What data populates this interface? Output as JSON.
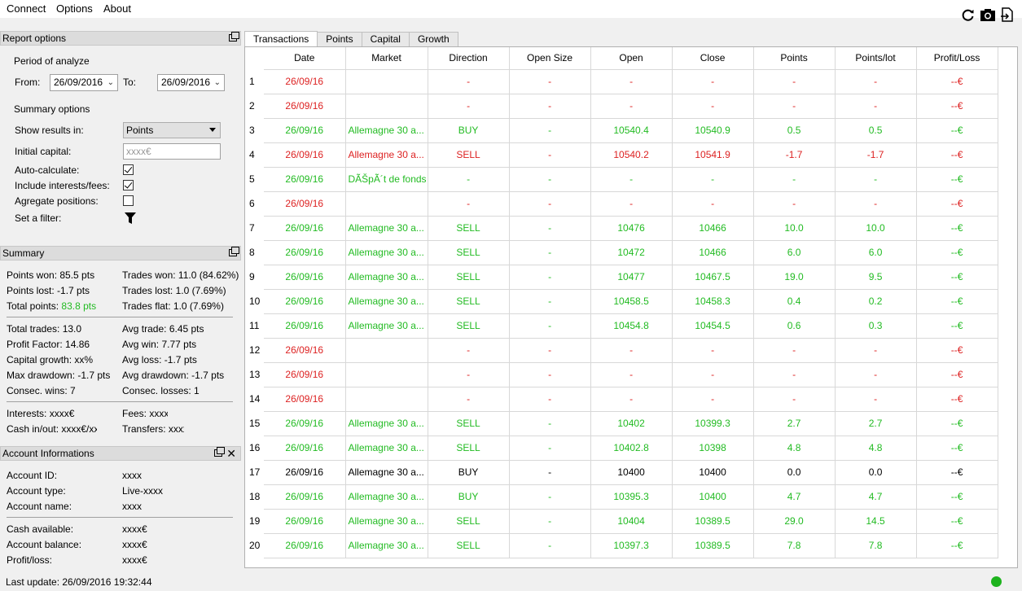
{
  "menu": {
    "connect": "Connect",
    "options": "Options",
    "about": "About"
  },
  "toolbar": {
    "refresh_icon": "refresh-icon",
    "camera_icon": "camera-icon",
    "export_icon": "export-icon"
  },
  "report_options": {
    "title": "Report options",
    "period_label": "Period of analyze",
    "from_label": "From:",
    "from_value": "26/09/2016",
    "to_label": "To:",
    "to_value": "26/09/2016",
    "summary_options_label": "Summary options",
    "show_results_label": "Show results in:",
    "show_results_value": "Points",
    "initial_capital_label": "Initial capital:",
    "initial_capital_placeholder": "xxxx€",
    "auto_calc_label": "Auto-calculate:",
    "auto_calc_checked": true,
    "include_fees_label": "Include interests/fees:",
    "include_fees_checked": true,
    "aggregate_label": "Agregate positions:",
    "aggregate_checked": false,
    "filter_label": "Set a filter:"
  },
  "summary": {
    "title": "Summary",
    "points_won": "Points won: 85.5 pts",
    "trades_won": "Trades won: 11.0 (84.62%)",
    "points_lost": "Points lost: -1.7 pts",
    "trades_lost": "Trades lost: 1.0 (7.69%)",
    "total_points_label": "Total points:",
    "total_points_value": "83.8 pts",
    "trades_flat": "Trades flat: 1.0 (7.69%)",
    "total_trades": "Total trades: 13.0",
    "avg_trade": "Avg trade: 6.45 pts",
    "profit_factor": "Profit Factor: 14.86",
    "avg_win": "Avg win: 7.77 pts",
    "capital_growth": "Capital growth: xx%",
    "avg_loss": "Avg loss: -1.7 pts",
    "max_drawdown": "Max drawdown: -1.7 pts",
    "avg_drawdown": "Avg drawdown: -1.7 pts",
    "consec_wins": "Consec. wins: 7",
    "consec_losses": "Consec. losses: 1",
    "interests": "Interests: xxxx€",
    "fees": "Fees: xxxx€",
    "cash_in_out": "Cash in/out: xxxx€/xxxx€",
    "transfers": "Transfers: xxxx€"
  },
  "account": {
    "title": "Account Informations",
    "id_label": "Account ID:",
    "id_value": "xxxx",
    "type_label": "Account type:",
    "type_value": "Live-xxxx",
    "name_label": "Account name:",
    "name_value": "xxxx",
    "cash_label": "Cash available:",
    "cash_value": "xxxx€",
    "balance_label": "Account balance:",
    "balance_value": "xxxx€",
    "pl_label": "Profit/loss:",
    "pl_value": "xxxx€"
  },
  "tabs": [
    "Transactions",
    "Points",
    "Capital",
    "Growth"
  ],
  "columns": [
    "Date",
    "Market",
    "Direction",
    "Open Size",
    "Open",
    "Close",
    "Points",
    "Points/lot",
    "Profit/Loss"
  ],
  "rows": [
    {
      "n": "1",
      "s": "r",
      "c": [
        "26/09/16",
        "",
        "-",
        "-",
        "-",
        "-",
        "-",
        "-",
        "--€"
      ]
    },
    {
      "n": "2",
      "s": "r",
      "c": [
        "26/09/16",
        "",
        "-",
        "-",
        "-",
        "-",
        "-",
        "-",
        "--€"
      ]
    },
    {
      "n": "3",
      "s": "g",
      "c": [
        "26/09/16",
        "Allemagne 30 a...",
        "BUY",
        "-",
        "10540.4",
        "10540.9",
        "0.5",
        "0.5",
        "--€"
      ]
    },
    {
      "n": "4",
      "s": "r",
      "c": [
        "26/09/16",
        "Allemagne 30 a...",
        "SELL",
        "-",
        "10540.2",
        "10541.9",
        "-1.7",
        "-1.7",
        "--€"
      ]
    },
    {
      "n": "5",
      "s": "g",
      "c": [
        "26/09/16",
        "DÃŠpÃ´t de fonds",
        "-",
        "-",
        "-",
        "-",
        "-",
        "-",
        "--€"
      ]
    },
    {
      "n": "6",
      "s": "r",
      "c": [
        "26/09/16",
        "",
        "-",
        "-",
        "-",
        "-",
        "-",
        "-",
        "--€"
      ]
    },
    {
      "n": "7",
      "s": "g",
      "c": [
        "26/09/16",
        "Allemagne 30 a...",
        "SELL",
        "-",
        "10476",
        "10466",
        "10.0",
        "10.0",
        "--€"
      ]
    },
    {
      "n": "8",
      "s": "g",
      "c": [
        "26/09/16",
        "Allemagne 30 a...",
        "SELL",
        "-",
        "10472",
        "10466",
        "6.0",
        "6.0",
        "--€"
      ]
    },
    {
      "n": "9",
      "s": "g",
      "c": [
        "26/09/16",
        "Allemagne 30 a...",
        "SELL",
        "-",
        "10477",
        "10467.5",
        "19.0",
        "9.5",
        "--€"
      ]
    },
    {
      "n": "10",
      "s": "g",
      "c": [
        "26/09/16",
        "Allemagne 30 a...",
        "SELL",
        "-",
        "10458.5",
        "10458.3",
        "0.4",
        "0.2",
        "--€"
      ]
    },
    {
      "n": "11",
      "s": "g",
      "c": [
        "26/09/16",
        "Allemagne 30 a...",
        "SELL",
        "-",
        "10454.8",
        "10454.5",
        "0.6",
        "0.3",
        "--€"
      ]
    },
    {
      "n": "12",
      "s": "r",
      "c": [
        "26/09/16",
        "",
        "-",
        "-",
        "-",
        "-",
        "-",
        "-",
        "--€"
      ]
    },
    {
      "n": "13",
      "s": "r",
      "c": [
        "26/09/16",
        "",
        "-",
        "-",
        "-",
        "-",
        "-",
        "-",
        "--€"
      ]
    },
    {
      "n": "14",
      "s": "r",
      "c": [
        "26/09/16",
        "",
        "-",
        "-",
        "-",
        "-",
        "-",
        "-",
        "--€"
      ]
    },
    {
      "n": "15",
      "s": "g",
      "c": [
        "26/09/16",
        "Allemagne 30 a...",
        "SELL",
        "-",
        "10402",
        "10399.3",
        "2.7",
        "2.7",
        "--€"
      ]
    },
    {
      "n": "16",
      "s": "g",
      "c": [
        "26/09/16",
        "Allemagne 30 a...",
        "SELL",
        "-",
        "10402.8",
        "10398",
        "4.8",
        "4.8",
        "--€"
      ]
    },
    {
      "n": "17",
      "s": "n",
      "c": [
        "26/09/16",
        "Allemagne 30 a...",
        "BUY",
        "-",
        "10400",
        "10400",
        "0.0",
        "0.0",
        "--€"
      ]
    },
    {
      "n": "18",
      "s": "g",
      "c": [
        "26/09/16",
        "Allemagne 30 a...",
        "BUY",
        "-",
        "10395.3",
        "10400",
        "4.7",
        "4.7",
        "--€"
      ]
    },
    {
      "n": "19",
      "s": "g",
      "c": [
        "26/09/16",
        "Allemagne 30 a...",
        "SELL",
        "-",
        "10404",
        "10389.5",
        "29.0",
        "14.5",
        "--€"
      ]
    },
    {
      "n": "20",
      "s": "g",
      "c": [
        "26/09/16",
        "Allemagne 30 a...",
        "SELL",
        "-",
        "10397.3",
        "10389.5",
        "7.8",
        "7.8",
        "--€"
      ]
    }
  ],
  "status": {
    "last_update": "Last update: 26/09/2016 19:32:44",
    "connection_color": "#1db31d"
  }
}
